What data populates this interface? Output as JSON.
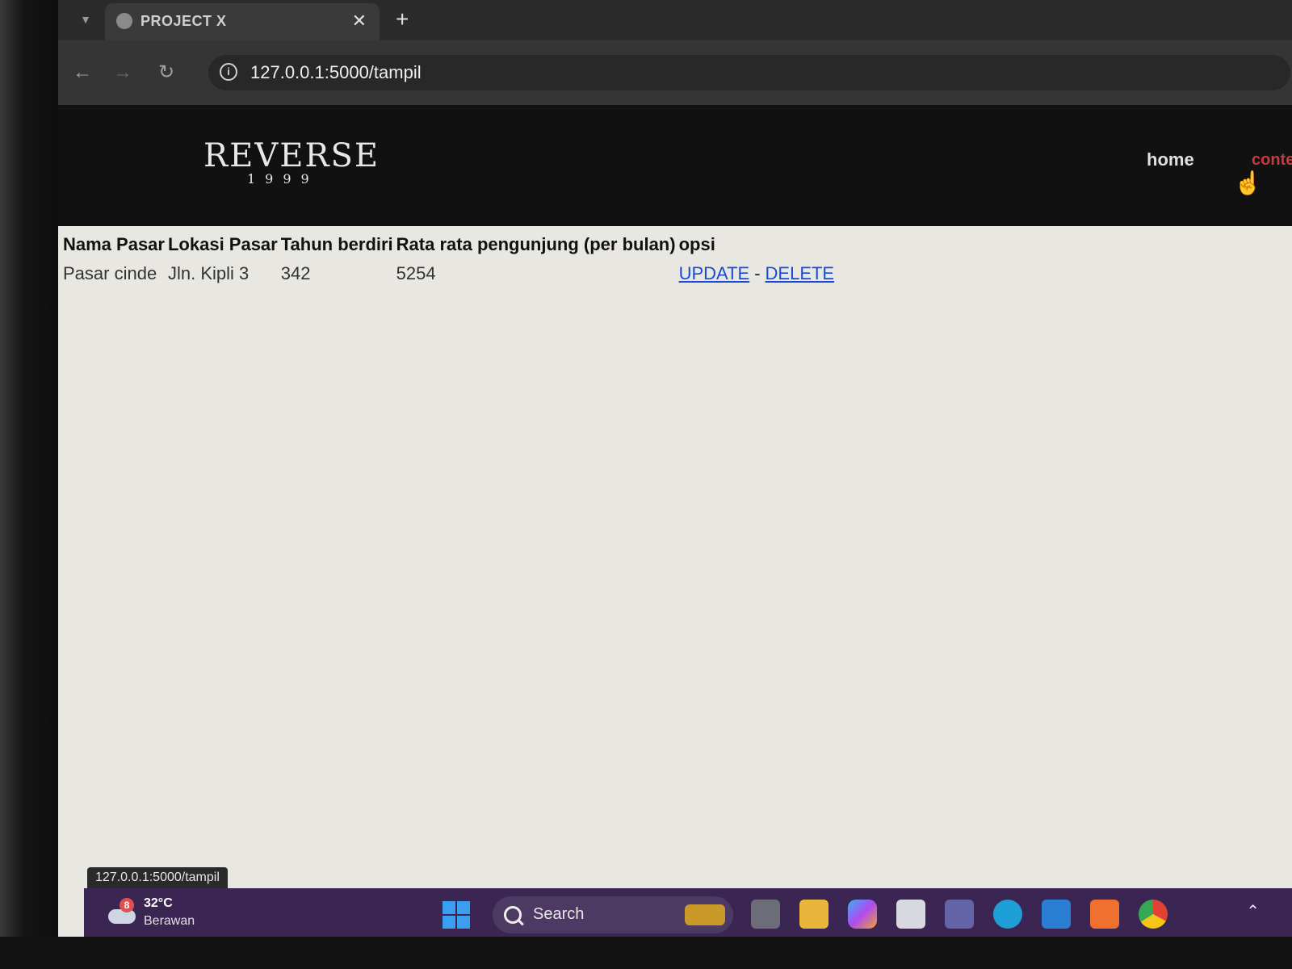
{
  "browser": {
    "tab_title": "PROJECT X",
    "tab_close_glyph": "✕",
    "new_tab_glyph": "+",
    "url": "127.0.0.1:5000/tampil"
  },
  "site": {
    "logo_main": "REVERSE",
    "logo_sub": "1999",
    "nav": {
      "home": "home",
      "content": "conten"
    }
  },
  "table": {
    "headers": [
      "Nama Pasar",
      "Lokasi Pasar",
      "Tahun berdiri",
      "Rata rata pengunjung (per bulan)",
      "opsi"
    ],
    "rows": [
      {
        "nama": "Pasar cinde",
        "lokasi": "Jln. Kipli 3",
        "tahun": "342",
        "pengunjung": "5254",
        "update": "UPDATE",
        "separator": "-",
        "delete": "DELETE"
      }
    ]
  },
  "status_bar": {
    "url": "127.0.0.1:5000/tampil"
  },
  "taskbar": {
    "weather_badge": "8",
    "temperature": "32°C",
    "weather_desc": "Berawan",
    "search_label": "Search"
  },
  "icons": [
    "globe-icon",
    "back-arrow-icon",
    "forward-arrow-icon",
    "reload-icon",
    "info-icon",
    "hand-cursor-icon",
    "windows-start-icon",
    "search-icon",
    "chevron-up-icon"
  ],
  "colors": {
    "link": "#1a4bd6",
    "nav_content": "#c63b3b",
    "header_bg": "#111111",
    "taskbar_bg": "#3b2552"
  }
}
